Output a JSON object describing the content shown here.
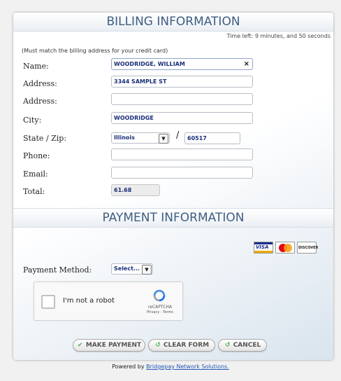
{
  "billing": {
    "title": "BILLING INFORMATION",
    "timer": "Time left: 9 minutes, and 50 seconds",
    "note": "(Must match the billing address for your credit card)",
    "labels": {
      "name": "Name:",
      "address1": "Address:",
      "address2": "Address:",
      "city": "City:",
      "state_zip": "State / Zip:",
      "phone": "Phone:",
      "email": "Email:",
      "total": "Total:"
    },
    "values": {
      "name": "WOODRIDGE, WILLIAM",
      "address1": "3344 SAMPLE ST",
      "address2": "",
      "city": "WOODRIDGE",
      "state": "Illinois",
      "zip": "60517",
      "phone": "",
      "email": "",
      "total": "61.68"
    },
    "clear_glyph": "×",
    "slash": "/"
  },
  "payment": {
    "title": "PAYMENT INFORMATION",
    "method_label": "Payment Method:",
    "method_value": "Select...",
    "cards": [
      "visa",
      "mastercard",
      "discover"
    ],
    "visa_text": "VISA",
    "discover_text": "DISCOVER"
  },
  "captcha": {
    "label": "I'm not a robot",
    "brand": "reCAPTCHA",
    "terms": "Privacy - Terms"
  },
  "buttons": {
    "make_payment": "MAKE PAYMENT",
    "clear_form": "CLEAR FORM",
    "cancel": "CANCEL"
  },
  "footer": {
    "prefix": "Powered by",
    "link": "Bridgepay Network Solutions."
  },
  "colors": {
    "header_text": "#3f5e81",
    "field_text": "#1a2f7a",
    "link": "#2258b6"
  }
}
